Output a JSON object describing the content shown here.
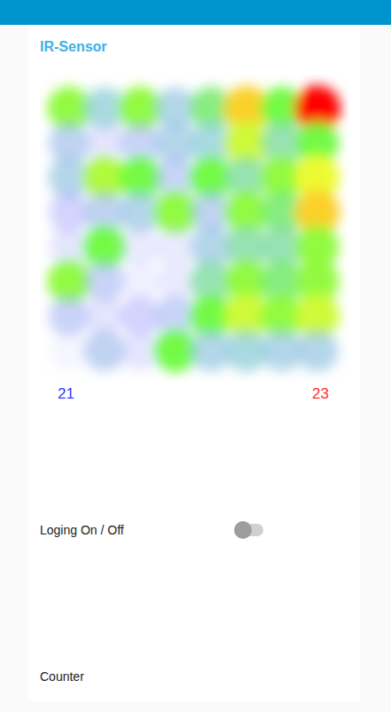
{
  "title": "IR-Sensor",
  "heatmap": {
    "rows": [
      [
        22.3,
        21.9,
        22.3,
        21.8,
        22.1,
        22.7,
        22.2,
        23.0
      ],
      [
        21.7,
        21.3,
        21.6,
        21.8,
        21.9,
        22.5,
        22.0,
        22.2
      ],
      [
        21.8,
        22.4,
        22.2,
        21.6,
        22.2,
        22.0,
        22.3,
        22.6
      ],
      [
        21.5,
        21.7,
        21.8,
        22.3,
        21.7,
        22.3,
        22.1,
        22.7
      ],
      [
        21.3,
        22.2,
        21.2,
        21.2,
        21.8,
        22.0,
        22.0,
        22.3
      ],
      [
        22.3,
        21.6,
        21.1,
        21.2,
        22.0,
        22.3,
        22.1,
        22.3
      ],
      [
        21.6,
        21.3,
        21.5,
        21.6,
        22.2,
        22.5,
        22.3,
        22.5
      ],
      [
        21.0,
        21.7,
        21.3,
        22.2,
        21.8,
        21.9,
        21.8,
        21.8
      ]
    ],
    "min_label": "21",
    "max_label": "23"
  },
  "logging": {
    "label": "Loging On / Off",
    "on": false
  },
  "counter": {
    "label": "Counter"
  }
}
